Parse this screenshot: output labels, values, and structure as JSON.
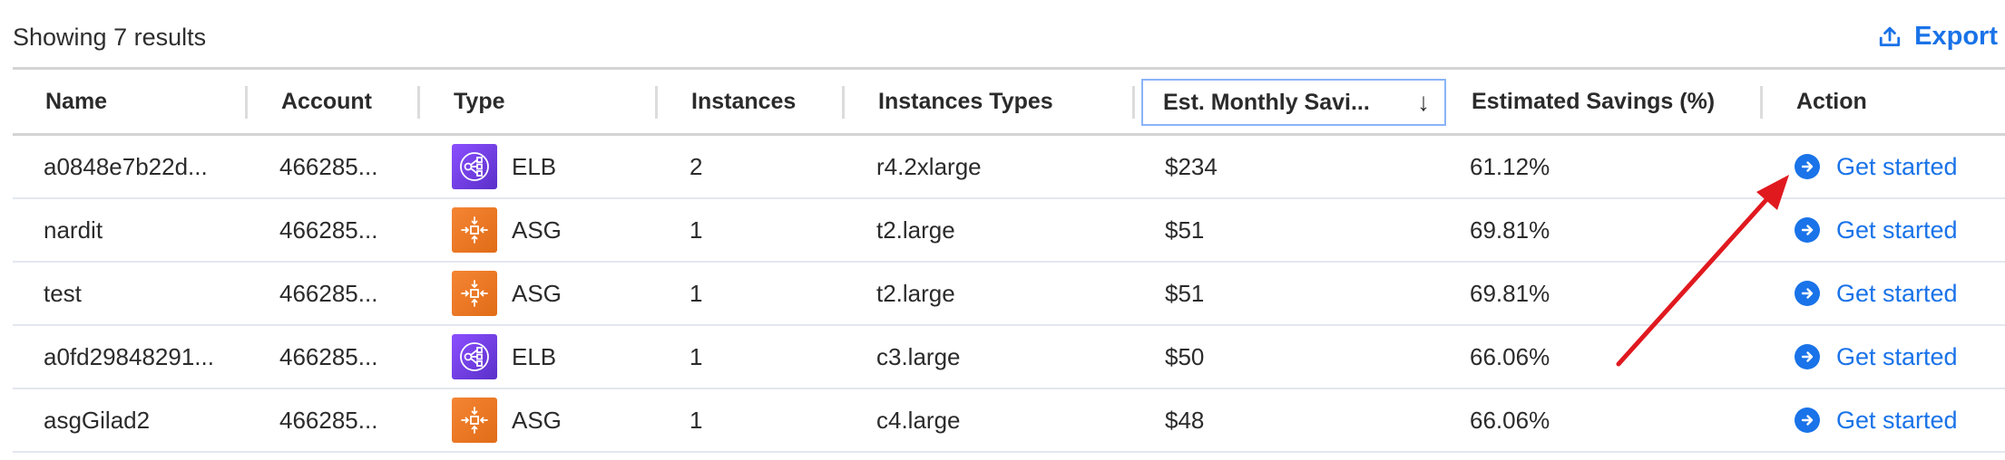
{
  "results_label": "Showing 7 results",
  "export_label": "Export",
  "columns": [
    {
      "key": "name",
      "label": "Name"
    },
    {
      "key": "account",
      "label": "Account"
    },
    {
      "key": "type",
      "label": "Type"
    },
    {
      "key": "instances",
      "label": "Instances"
    },
    {
      "key": "instance_types",
      "label": "Instances Types"
    },
    {
      "key": "savings",
      "label": "Est. Monthly Savi..."
    },
    {
      "key": "savings_pct",
      "label": "Estimated Savings (%)"
    },
    {
      "key": "action",
      "label": "Action"
    }
  ],
  "sorted_column": "Est. Monthly Savings",
  "sort_direction": "descending",
  "rows": [
    {
      "name": "a0848e7b22d...",
      "account": "466285...",
      "type": "ELB",
      "type_icon": "elb-icon",
      "instances": "2",
      "instance_types": "r4.2xlarge",
      "savings": "$234",
      "savings_pct": "61.12%",
      "action": "Get started"
    },
    {
      "name": "nardit",
      "account": "466285...",
      "type": "ASG",
      "type_icon": "asg-icon",
      "instances": "1",
      "instance_types": "t2.large",
      "savings": "$51",
      "savings_pct": "69.81%",
      "action": "Get started"
    },
    {
      "name": "test",
      "account": "466285...",
      "type": "ASG",
      "type_icon": "asg-icon",
      "instances": "1",
      "instance_types": "t2.large",
      "savings": "$51",
      "savings_pct": "69.81%",
      "action": "Get started"
    },
    {
      "name": "a0fd29848291...",
      "account": "466285...",
      "type": "ELB",
      "type_icon": "elb-icon",
      "instances": "1",
      "instance_types": "c3.large",
      "savings": "$50",
      "savings_pct": "66.06%",
      "action": "Get started"
    },
    {
      "name": "asgGilad2",
      "account": "466285...",
      "type": "ASG",
      "type_icon": "asg-icon",
      "instances": "1",
      "instance_types": "c4.large",
      "savings": "$48",
      "savings_pct": "66.06%",
      "action": "Get started"
    }
  ],
  "colors": {
    "link": "#1a73e8",
    "elb": "#7b42f0",
    "asg": "#ed7a26",
    "annotation_arrow": "#e0191f"
  },
  "annotation": {
    "type": "arrow",
    "points_to": "first row Get started button"
  }
}
